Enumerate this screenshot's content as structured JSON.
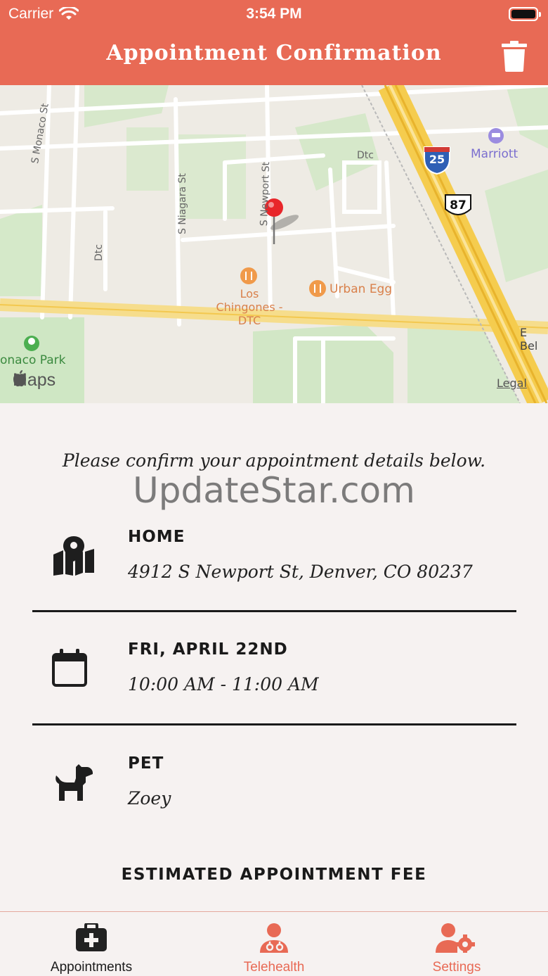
{
  "status_bar": {
    "carrier": "Carrier",
    "time": "3:54 PM"
  },
  "header": {
    "title": "Appointment Confirmation"
  },
  "map": {
    "labels": {
      "monaco_st": "S Monaco St",
      "niagara_st": "S Niagara St",
      "newport_st": "S Newport St",
      "dtc_left": "Dtc",
      "dtc_top": "Dtc",
      "marriott": "Marriott",
      "interstate": "25",
      "us_route": "87",
      "los_chingones": "Los",
      "los_chingones_2": "Chingones -",
      "los_chingones_3": "DTC",
      "urban_egg": "Urban Egg",
      "monaco_park": "onaco Park",
      "belleview": "E Bel",
      "maps_brand": "Maps",
      "legal": "Legal"
    }
  },
  "content": {
    "intro": "Please confirm your appointment details below.",
    "watermark": "UpdateStar.com",
    "location": {
      "title": "HOME",
      "address": "4912 S Newport St, Denver, CO 80237"
    },
    "date": {
      "title": "FRI, APRIL 22ND",
      "time": "10:00 AM - 11:00 AM"
    },
    "pet": {
      "title": "PET",
      "name": "Zoey"
    },
    "fee_title": "ESTIMATED APPOINTMENT FEE"
  },
  "tabbar": {
    "tabs": [
      {
        "label": "Appointments",
        "active": true
      },
      {
        "label": "Telehealth",
        "active": false
      },
      {
        "label": "Settings",
        "active": false
      }
    ]
  },
  "colors": {
    "accent": "#e86a55",
    "background": "#f6f2f1",
    "text": "#1a1a1a"
  }
}
